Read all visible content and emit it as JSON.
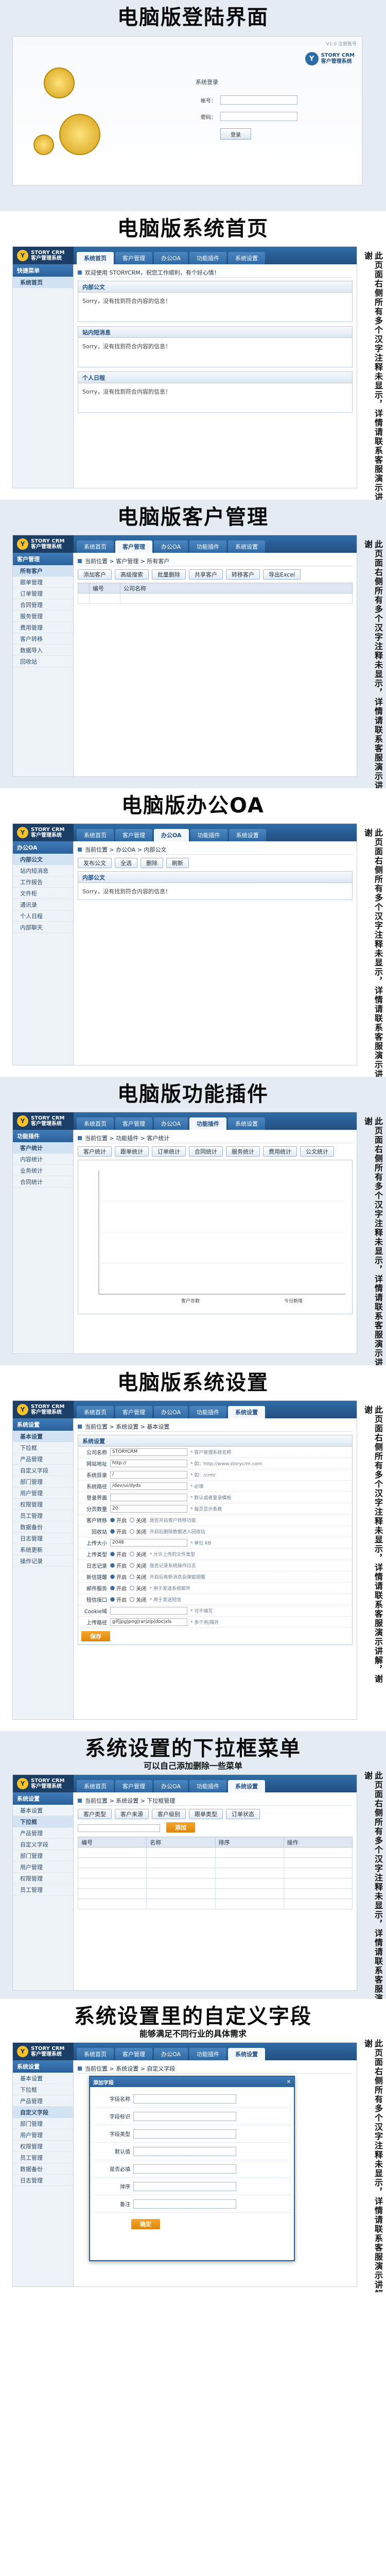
{
  "side_note": "此页面右侧所有多个汉字注释未显示，详情请联系客服演示讲解，谢谢",
  "brand": {
    "code": "STORY CRM",
    "name": "客户管理系统",
    "mark": "Y"
  },
  "login": {
    "title": "电脑版登陆界面",
    "version": "V1.0 注册账号",
    "form_title": "系统登录",
    "user_label": "帐号：",
    "pass_label": "密码：",
    "login_btn": "登录"
  },
  "home": {
    "title": "电脑版系统首页",
    "tabs": [
      "系统首页",
      "客户管理",
      "办公OA",
      "功能插件",
      "系统设置"
    ],
    "side_head": "快捷菜单",
    "side_items": [
      "系统首页"
    ],
    "welcome": "欢迎使用 STORYCRM，祝您工作顺利，有个好心情！",
    "boxes": [
      {
        "title": "内部公文",
        "body": "Sorry，没有找到符合内容的信息！"
      },
      {
        "title": "站内短消息",
        "body": "Sorry，没有找到符合内容的信息！"
      },
      {
        "title": "个人日程",
        "body": "Sorry，没有找到符合内容的信息！"
      }
    ]
  },
  "customer": {
    "title": "电脑版客户管理",
    "side_head": "客户管理",
    "side_items": [
      "所有客户",
      "跟单管理",
      "订单管理",
      "合同管理",
      "服务管理",
      "费用管理",
      "客户转移",
      "数据导入",
      "回收站"
    ],
    "crumb": "当前位置 > 客户管理 > 所有客户",
    "buttons": [
      "添加客户",
      "高级搜索",
      "批量删除",
      "共享客户",
      "转移客户",
      "导出Excel"
    ],
    "columns": [
      "",
      "编号",
      "公司名称"
    ],
    "empty": ""
  },
  "oa": {
    "title": "电脑版办公OA",
    "side_head": "办公OA",
    "side_items": [
      "内部公文",
      "站内短消息",
      "工作报告",
      "文件柜",
      "通讯录",
      "个人日程",
      "内部聊天"
    ],
    "crumb": "当前位置 > 办公OA > 内部公文",
    "buttons": [
      "发布公文",
      "全选",
      "删除",
      "刷新"
    ],
    "box_title": "内部公文",
    "empty": "Sorry，没有找到符合内容的信息！"
  },
  "plugin": {
    "title": "电脑版功能插件",
    "side_head": "功能插件",
    "side_items": [
      "客户统计",
      "内容统计",
      "业务统计",
      "合同统计"
    ],
    "crumb": "当前位置 > 功能插件 > 客户统计",
    "chart_tabs": [
      "客户统计",
      "跟单统计",
      "订单统计",
      "合同统计",
      "服务统计",
      "费用统计",
      "公文统计"
    ],
    "chart_x_labels": [
      "客户总数",
      "今日新增"
    ]
  },
  "settings": {
    "title": "电脑版系统设置",
    "side_head": "系统设置",
    "side_items": [
      "基本设置",
      "下拉框",
      "产品管理",
      "自定义字段",
      "部门管理",
      "用户管理",
      "权限管理",
      "员工管理",
      "数据备份",
      "日志管理",
      "系统更新",
      "操作记录"
    ],
    "crumb": "当前位置 > 系统设置 > 基本设置",
    "box_title": "系统设置",
    "save_btn": "保存",
    "rows": [
      {
        "label": "公司名称",
        "value": "STORYCRM",
        "hint": "* 客户管理系统名称"
      },
      {
        "label": "网站地址",
        "value": "http://",
        "hint": "* 如：http://www.storycrm.com"
      },
      {
        "label": "系统目录",
        "value": "/",
        "hint": "* 如：/crm/"
      },
      {
        "label": "系统路径",
        "value": "/dev/ui/dyds",
        "hint": "* 必填"
      },
      {
        "label": "登录界面",
        "value": "",
        "hint": "* 默认或者登录模板"
      },
      {
        "label": "分页数量",
        "value": "20",
        "hint": "* 每页显示条数"
      },
      {
        "label": "客户转移",
        "value": "",
        "hint": "是否开启客户转移功能"
      },
      {
        "label": "回收站",
        "value": "",
        "hint": "开启后删除数据进入回收站"
      },
      {
        "label": "上传大小",
        "value": "2048",
        "hint": "* 单位 KB"
      },
      {
        "label": "上传类型",
        "value": "",
        "hint": "* 允许上传的文件类型"
      },
      {
        "label": "日志记录",
        "value": "",
        "hint": "是否记录系统操作日志"
      },
      {
        "label": "新信提醒",
        "value": "",
        "hint": "开启后有新消息会弹窗提醒"
      },
      {
        "label": "邮件服务",
        "value": "",
        "hint": "* 用于发送系统邮件"
      },
      {
        "label": "短信接口",
        "value": "",
        "hint": "* 用于发送短信"
      },
      {
        "label": "Cookie域",
        "value": "",
        "hint": "* 可不填写"
      },
      {
        "label": "上传路径",
        "value": "gif|jpg|png|rar|zip|doc|xls",
        "hint": "* 多个用|隔开"
      }
    ],
    "radio_on": "开启",
    "radio_off": "关闭"
  },
  "dropdown": {
    "title": "系统设置的下拉框菜单",
    "subtitle": "可以自己添加删除一些菜单",
    "crumb": "当前位置 > 系统设置 > 下拉框管理",
    "tabs": [
      "客户类型",
      "客户来源",
      "客户级别",
      "跟单类型",
      "订单状态"
    ],
    "add_btn": "添加",
    "columns": [
      "编号",
      "名称",
      "排序",
      "操作"
    ]
  },
  "custom": {
    "title": "系统设置里的自定义字段",
    "subtitle": "能够满足不同行业的具体需求",
    "crumb": "当前位置 > 系统设置 > 自定义字段",
    "modal_title": "添加字段",
    "modal_rows": [
      "字段名称",
      "字段标识",
      "字段类型",
      "默认值",
      "是否必填",
      "排序",
      "备注"
    ],
    "modal_btn": "确定"
  }
}
